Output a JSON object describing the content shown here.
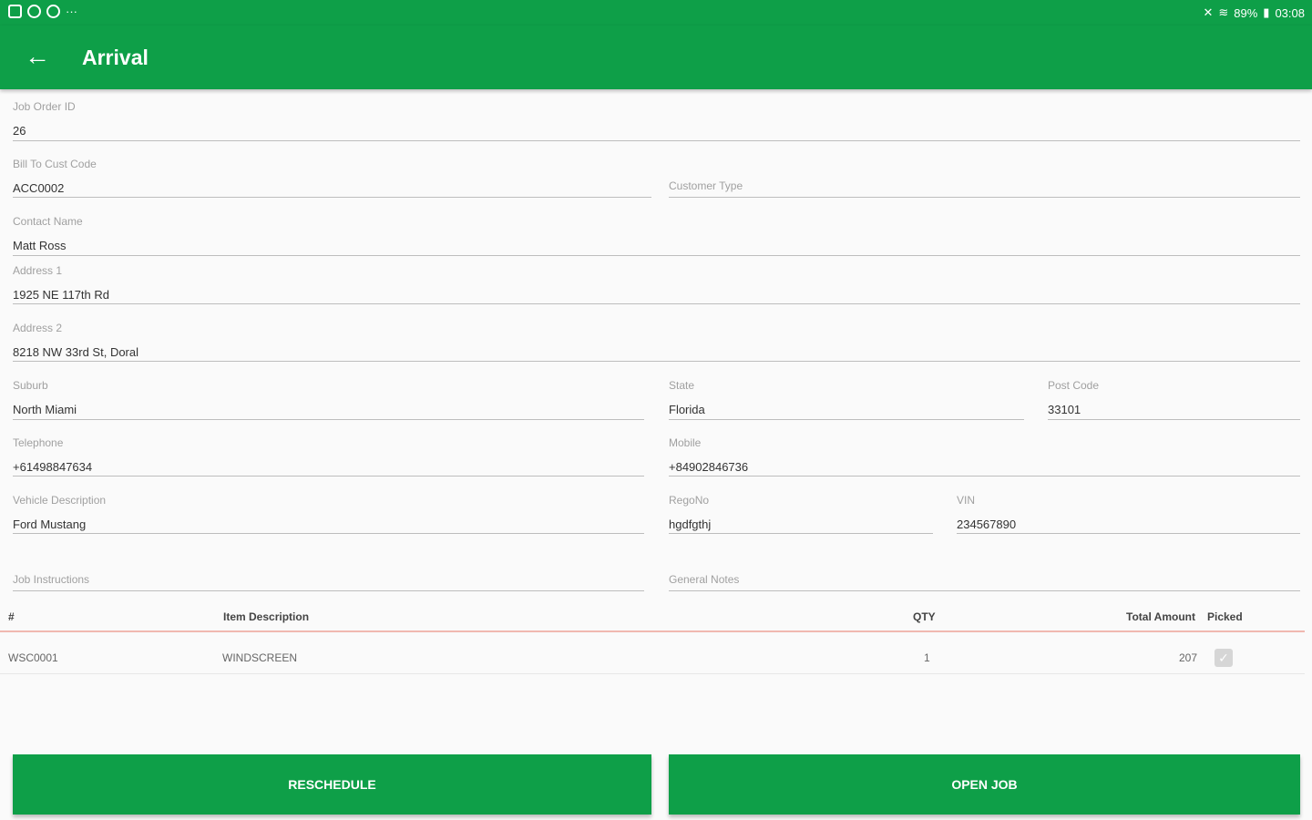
{
  "status_bar": {
    "icons_left": [
      "image-icon",
      "settings-icon",
      "cloud-icon"
    ],
    "more": "···",
    "battery": "89%",
    "time": "03:08"
  },
  "app_bar": {
    "title": "Arrival"
  },
  "form": {
    "job_order_id": {
      "label": "Job Order ID",
      "value": "26"
    },
    "bill_to_cust_code": {
      "label": "Bill To Cust Code",
      "value": "ACC0002"
    },
    "customer_type": {
      "placeholder": "Customer Type"
    },
    "contact_name": {
      "label": "Contact Name",
      "value": "Matt Ross"
    },
    "address1": {
      "label": "Address 1",
      "value": "1925 NE 117th Rd"
    },
    "address2": {
      "label": "Address 2",
      "value": "8218 NW 33rd St, Doral"
    },
    "suburb": {
      "label": "Suburb",
      "value": "North Miami"
    },
    "state": {
      "label": "State",
      "value": "Florida"
    },
    "post_code": {
      "label": "Post Code",
      "value": "33101"
    },
    "telephone": {
      "label": "Telephone",
      "value": "+61498847634"
    },
    "mobile": {
      "label": "Mobile",
      "value": "+84902846736"
    },
    "vehicle_description": {
      "label": "Vehicle Description",
      "value": "Ford Mustang"
    },
    "rego_no": {
      "label": "RegoNo",
      "value": "hgdfgthj"
    },
    "vin": {
      "label": "VIN",
      "value": "234567890"
    },
    "job_instructions": {
      "placeholder": "Job Instructions"
    },
    "general_notes": {
      "placeholder": "General Notes"
    }
  },
  "table": {
    "headers": {
      "num": "#",
      "item": "Item Description",
      "qty": "QTY",
      "total": "Total Amount",
      "picked": "Picked"
    },
    "rows": [
      {
        "num": "WSC0001",
        "item": "WINDSCREEN",
        "qty": "1",
        "total": "207",
        "picked": true
      }
    ]
  },
  "buttons": {
    "reschedule": "RESCHEDULE",
    "open_job": "OPEN JOB"
  },
  "colors": {
    "primary": "#0e9f48",
    "header_divider": "#f0b8b0"
  }
}
